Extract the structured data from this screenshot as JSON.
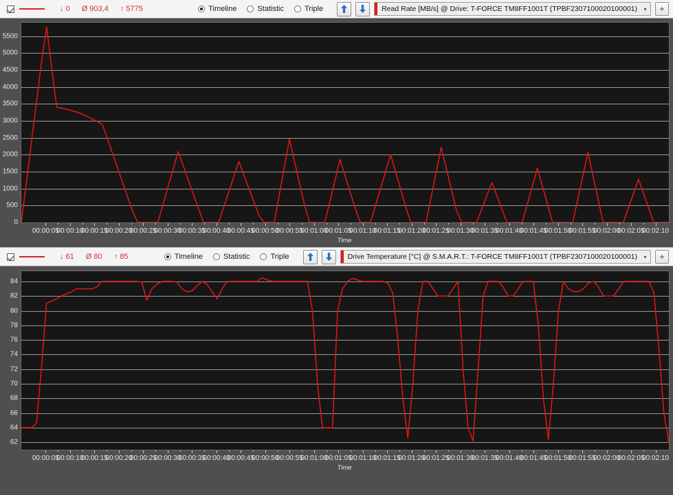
{
  "panels": [
    {
      "id": "read-rate",
      "checkbox_checked": true,
      "legend_color": "#e02020",
      "stats": {
        "min_label": "↓ 0",
        "avg_label": "Ø 903,4",
        "max_label": "↑ 5775"
      },
      "view_modes": [
        {
          "label": "Timeline",
          "selected": true
        },
        {
          "label": "Statistic",
          "selected": false
        },
        {
          "label": "Triple",
          "selected": false
        }
      ],
      "buttons": {
        "move_up": "up-arrow",
        "move_down": "down-arrow",
        "add": "+"
      },
      "source_select": {
        "value": "Read Rate [MB/s] @ Drive: T-FORCE TM8FF1001T (TPBF2307100020100001)",
        "arrow": "▾"
      },
      "chart_data": {
        "type": "line",
        "title": "Read Rate [MB/s] @ Drive: T-FORCE TM8FF1001T (TPBF2307100020100001)",
        "xlabel": "Time",
        "ylabel": "",
        "ylim": [
          0,
          5900
        ],
        "yticks": [
          0,
          500,
          1000,
          1500,
          2000,
          2500,
          3000,
          3500,
          4000,
          4500,
          5000,
          5500
        ],
        "grid": true,
        "legend_position": "top-left",
        "series": [
          {
            "name": "Read Rate [MB/s]",
            "color": "#e81515",
            "x": [
              0,
              1,
              2,
              3,
              4,
              5,
              6,
              7,
              8,
              9,
              10,
              11,
              12,
              13,
              14,
              15,
              16,
              17,
              18,
              19,
              20,
              21,
              22,
              23,
              24,
              25,
              26,
              27,
              28,
              29,
              30,
              31,
              32,
              33,
              34,
              35,
              36,
              37,
              38,
              39,
              40,
              41,
              42,
              43,
              44,
              45,
              46,
              47,
              48,
              49,
              50,
              51,
              52,
              53,
              54,
              55,
              56,
              57,
              58,
              59,
              60,
              61,
              62,
              63,
              64,
              65,
              66,
              67,
              68,
              69,
              70,
              71,
              72,
              73,
              74,
              75,
              76,
              77,
              78,
              79,
              80,
              81,
              82,
              83,
              84,
              85,
              86,
              87,
              88,
              89,
              90,
              91,
              92,
              93,
              94,
              95,
              96,
              97,
              98,
              99,
              100,
              101,
              102,
              103,
              104,
              105,
              106,
              107,
              108,
              109,
              110,
              111,
              112,
              113,
              114,
              115,
              116,
              117,
              118,
              119,
              120,
              121,
              122,
              123,
              124,
              125,
              126,
              127,
              128,
              129,
              130
            ],
            "values": [
              0,
              1180,
              2380,
              3560,
              4740,
              5775,
              4560,
              3400,
              3370,
              3340,
              3300,
              3260,
              3200,
              3130,
              3060,
              2980,
              2900,
              2480,
              2050,
              1620,
              1190,
              760,
              330,
              0,
              0,
              0,
              0,
              0,
              520,
              1050,
              1570,
              2090,
              1680,
              1250,
              830,
              420,
              0,
              0,
              0,
              0,
              450,
              900,
              1350,
              1800,
              1400,
              1000,
              600,
              200,
              0,
              0,
              0,
              820,
              1640,
              2460,
              1800,
              1150,
              500,
              0,
              0,
              0,
              0,
              620,
              1240,
              1860,
              1380,
              900,
              420,
              0,
              0,
              0,
              500,
              1000,
              1500,
              2000,
              1480,
              970,
              450,
              0,
              0,
              0,
              0,
              740,
              1480,
              2220,
              1600,
              980,
              370,
              0,
              0,
              0,
              0,
              390,
              790,
              1180,
              790,
              390,
              0,
              0,
              0,
              0,
              530,
              1060,
              1600,
              1070,
              540,
              0,
              0,
              0,
              0,
              0,
              690,
              1380,
              2070,
              1380,
              690,
              0,
              0,
              0,
              0,
              0,
              430,
              860,
              1280,
              860,
              430,
              0,
              0,
              0,
              0
            ]
          }
        ],
        "xticks": [
          "00:00:05",
          "00:00:10",
          "00:00:15",
          "00:00:20",
          "00:00:25",
          "00:00:30",
          "00:00:35",
          "00:00:40",
          "00:00:45",
          "00:00:50",
          "00:00:55",
          "00:01:00",
          "00:01:05",
          "00:01:10",
          "00:01:15",
          "00:01:20",
          "00:01:25",
          "00:01:30",
          "00:01:35",
          "00:01:40",
          "00:01:45",
          "00:01:50",
          "00:01:55",
          "00:02:00",
          "00:02:05",
          "00:02:10"
        ]
      }
    },
    {
      "id": "drive-temperature",
      "checkbox_checked": true,
      "legend_color": "#e02020",
      "stats": {
        "min_label": "↓ 61",
        "avg_label": "Ø 80",
        "max_label": "↑ 85"
      },
      "view_modes": [
        {
          "label": "Timeline",
          "selected": true
        },
        {
          "label": "Statistic",
          "selected": false
        },
        {
          "label": "Triple",
          "selected": false
        }
      ],
      "buttons": {
        "move_up": "up-arrow",
        "move_down": "down-arrow",
        "add": "+"
      },
      "source_select": {
        "value": "Drive Temperature [°C] @ S.M.A.R.T.: T-FORCE TM8FF1001T (TPBF2307100020100001)",
        "arrow": "▾"
      },
      "chart_data": {
        "type": "line",
        "title": "Drive Temperature [°C] @ S.M.A.R.T.: T-FORCE TM8FF1001T (TPBF2307100020100001)",
        "xlabel": "Time",
        "ylabel": "",
        "ylim": [
          61,
          85.4
        ],
        "yticks": [
          62,
          64,
          66,
          68,
          70,
          72,
          74,
          76,
          78,
          80,
          82,
          84
        ],
        "grid": true,
        "legend_position": "top-left",
        "series": [
          {
            "name": "Drive Temperature [°C]",
            "color": "#e81515",
            "x": [
              0,
              1,
              2,
              3,
              4,
              5,
              6,
              7,
              8,
              9,
              10,
              11,
              12,
              13,
              14,
              15,
              16,
              17,
              18,
              19,
              20,
              21,
              22,
              23,
              24,
              25,
              26,
              27,
              28,
              29,
              30,
              31,
              32,
              33,
              34,
              35,
              36,
              37,
              38,
              39,
              40,
              41,
              42,
              43,
              44,
              45,
              46,
              47,
              48,
              49,
              50,
              51,
              52,
              53,
              54,
              55,
              56,
              57,
              58,
              59,
              60,
              61,
              62,
              63,
              64,
              65,
              66,
              67,
              68,
              69,
              70,
              71,
              72,
              73,
              74,
              75,
              76,
              77,
              78,
              79,
              80,
              81,
              82,
              83,
              84,
              85,
              86,
              87,
              88,
              89,
              90,
              91,
              92,
              93,
              94,
              95,
              96,
              97,
              98,
              99,
              100,
              101,
              102,
              103,
              104,
              105,
              106,
              107,
              108,
              109,
              110,
              111,
              112,
              113,
              114,
              115,
              116,
              117,
              118,
              119,
              120,
              121,
              122,
              123,
              124,
              125,
              126,
              127,
              128,
              129,
              130
            ],
            "values": [
              64,
              64,
              64,
              64.6,
              72,
              81,
              81.3,
              81.6,
              82,
              82.3,
              82.6,
              83,
              83,
              83,
              83,
              83.2,
              84,
              84,
              84,
              84,
              84,
              84,
              84,
              84,
              83.9,
              81.4,
              83,
              83.6,
              84,
              84,
              84,
              83.9,
              83,
              82.6,
              82.7,
              83.4,
              84,
              83.6,
              82.6,
              81.6,
              83,
              84,
              84,
              84,
              84,
              84,
              84,
              84,
              84.5,
              84.2,
              84,
              84,
              84,
              84,
              84,
              84,
              84,
              84,
              80,
              70,
              64,
              64,
              64,
              80,
              83,
              84,
              84.4,
              84.2,
              84,
              84,
              84,
              84,
              84,
              83.8,
              82.4,
              76,
              68,
              62.6,
              70,
              80,
              84,
              84,
              83,
              82,
              82,
              82,
              83,
              84,
              72,
              64,
              62.2,
              72,
              82,
              84,
              84,
              84,
              83.2,
              82,
              82,
              83,
              84,
              84,
              84,
              78,
              68,
              62.4,
              70,
              80,
              84,
              83,
              82.6,
              82.6,
              83,
              83.8,
              84,
              83.2,
              82,
              82,
              82,
              83,
              84,
              84,
              84,
              84,
              84,
              84,
              82.5,
              75,
              66,
              62
            ]
          }
        ],
        "xticks": [
          "00:00:05",
          "00:00:10",
          "00:00:15",
          "00:00:20",
          "00:00:25",
          "00:00:30",
          "00:00:35",
          "00:00:40",
          "00:00:45",
          "00:00:50",
          "00:00:55",
          "00:01:00",
          "00:01:05",
          "00:01:10",
          "00:01:15",
          "00:01:20",
          "00:01:25",
          "00:01:30",
          "00:01:35",
          "00:01:40",
          "00:01:45",
          "00:01:50",
          "00:01:55",
          "00:02:00",
          "00:02:05",
          "00:02:10"
        ]
      }
    }
  ]
}
